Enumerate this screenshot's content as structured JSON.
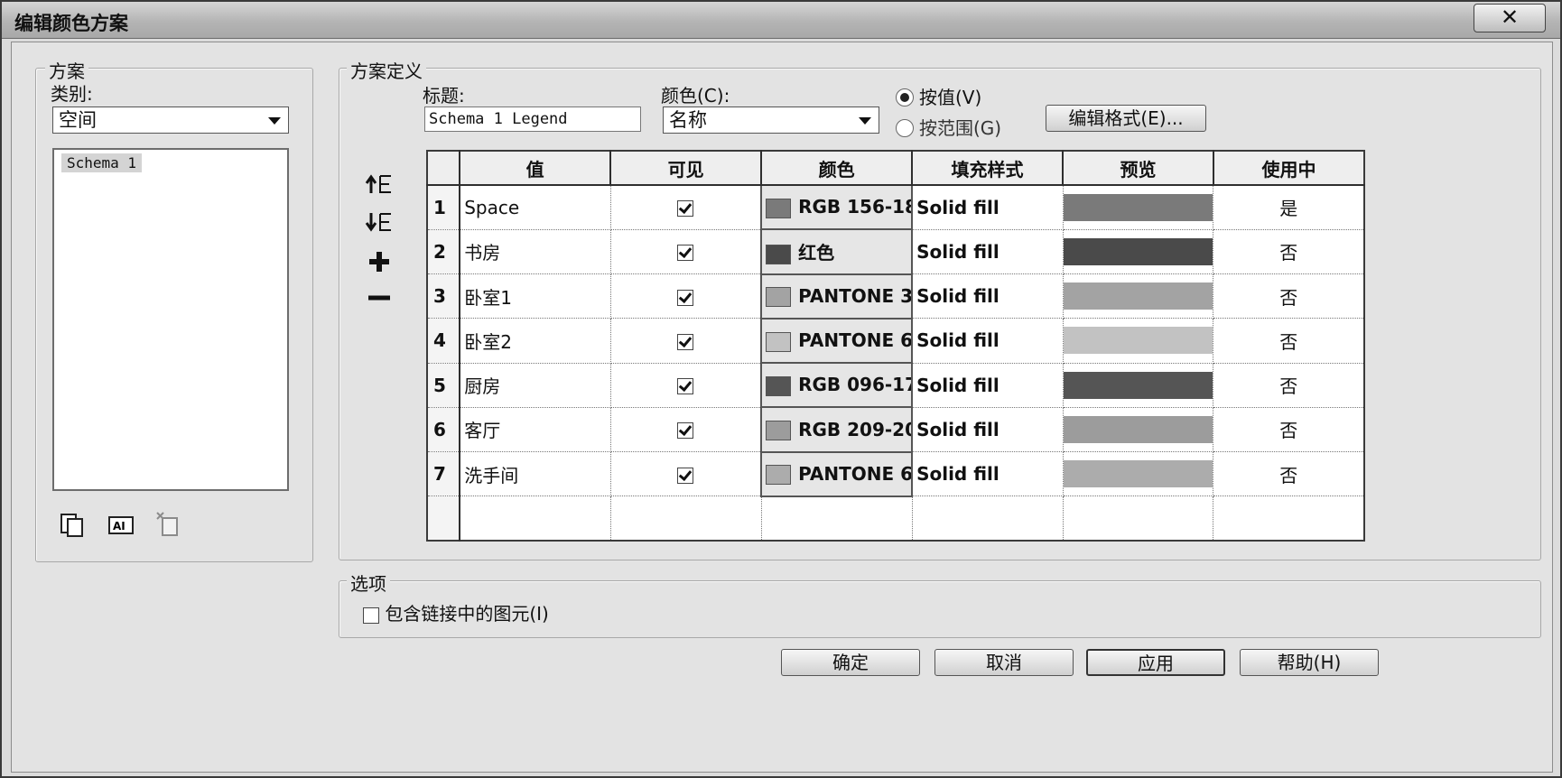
{
  "window": {
    "title": "编辑颜色方案",
    "close_glyph": "✕"
  },
  "scheme": {
    "legend": "方案",
    "category_label": "类别:",
    "category_value": "空间",
    "list_items": [
      "Schema 1"
    ],
    "icons": [
      "duplicate-icon",
      "rename-icon",
      "delete-icon"
    ]
  },
  "definition": {
    "legend": "方案定义",
    "title_label": "标题:",
    "title_value": "Schema 1 Legend",
    "color_label": "颜色(C):",
    "color_value": "名称",
    "radio_by_value": "按值(V)",
    "radio_by_range": "按范围(G)",
    "selected_radio": "by_value",
    "edit_format_button": "编辑格式(E)...",
    "columns": [
      "值",
      "可见",
      "颜色",
      "填充样式",
      "预览",
      "使用中"
    ],
    "rows": [
      {
        "n": "1",
        "value": "Space",
        "visible": true,
        "color": "RGB 156-18",
        "swatch": "#7a7a7a",
        "fill": "Solid fill",
        "preview": "#7a7a7a",
        "in_use": "是"
      },
      {
        "n": "2",
        "value": "书房",
        "visible": true,
        "color": "红色",
        "swatch": "#4a4a4a",
        "fill": "Solid fill",
        "preview": "#4a4a4a",
        "in_use": "否"
      },
      {
        "n": "3",
        "value": "卧室1",
        "visible": true,
        "color": "PANTONE 3",
        "swatch": "#a3a3a3",
        "fill": "Solid fill",
        "preview": "#a3a3a3",
        "in_use": "否"
      },
      {
        "n": "4",
        "value": "卧室2",
        "visible": true,
        "color": "PANTONE 6",
        "swatch": "#c2c2c2",
        "fill": "Solid fill",
        "preview": "#c2c2c2",
        "in_use": "否"
      },
      {
        "n": "5",
        "value": "厨房",
        "visible": true,
        "color": "RGB 096-17",
        "swatch": "#555555",
        "fill": "Solid fill",
        "preview": "#555555",
        "in_use": "否"
      },
      {
        "n": "6",
        "value": "客厅",
        "visible": true,
        "color": "RGB 209-20",
        "swatch": "#9c9c9c",
        "fill": "Solid fill",
        "preview": "#9c9c9c",
        "in_use": "否"
      },
      {
        "n": "7",
        "value": "洗手间",
        "visible": true,
        "color": "PANTONE 6",
        "swatch": "#acacac",
        "fill": "Solid fill",
        "preview": "#acacac",
        "in_use": "否"
      }
    ],
    "toolbar": [
      "move-up-icon",
      "move-down-icon",
      "add-icon",
      "remove-icon"
    ]
  },
  "options": {
    "legend": "选项",
    "include_linked_label": "包含链接中的图元(I)",
    "include_linked_checked": false
  },
  "buttons": {
    "ok": "确定",
    "cancel": "取消",
    "apply": "应用",
    "help": "帮助(H)"
  }
}
